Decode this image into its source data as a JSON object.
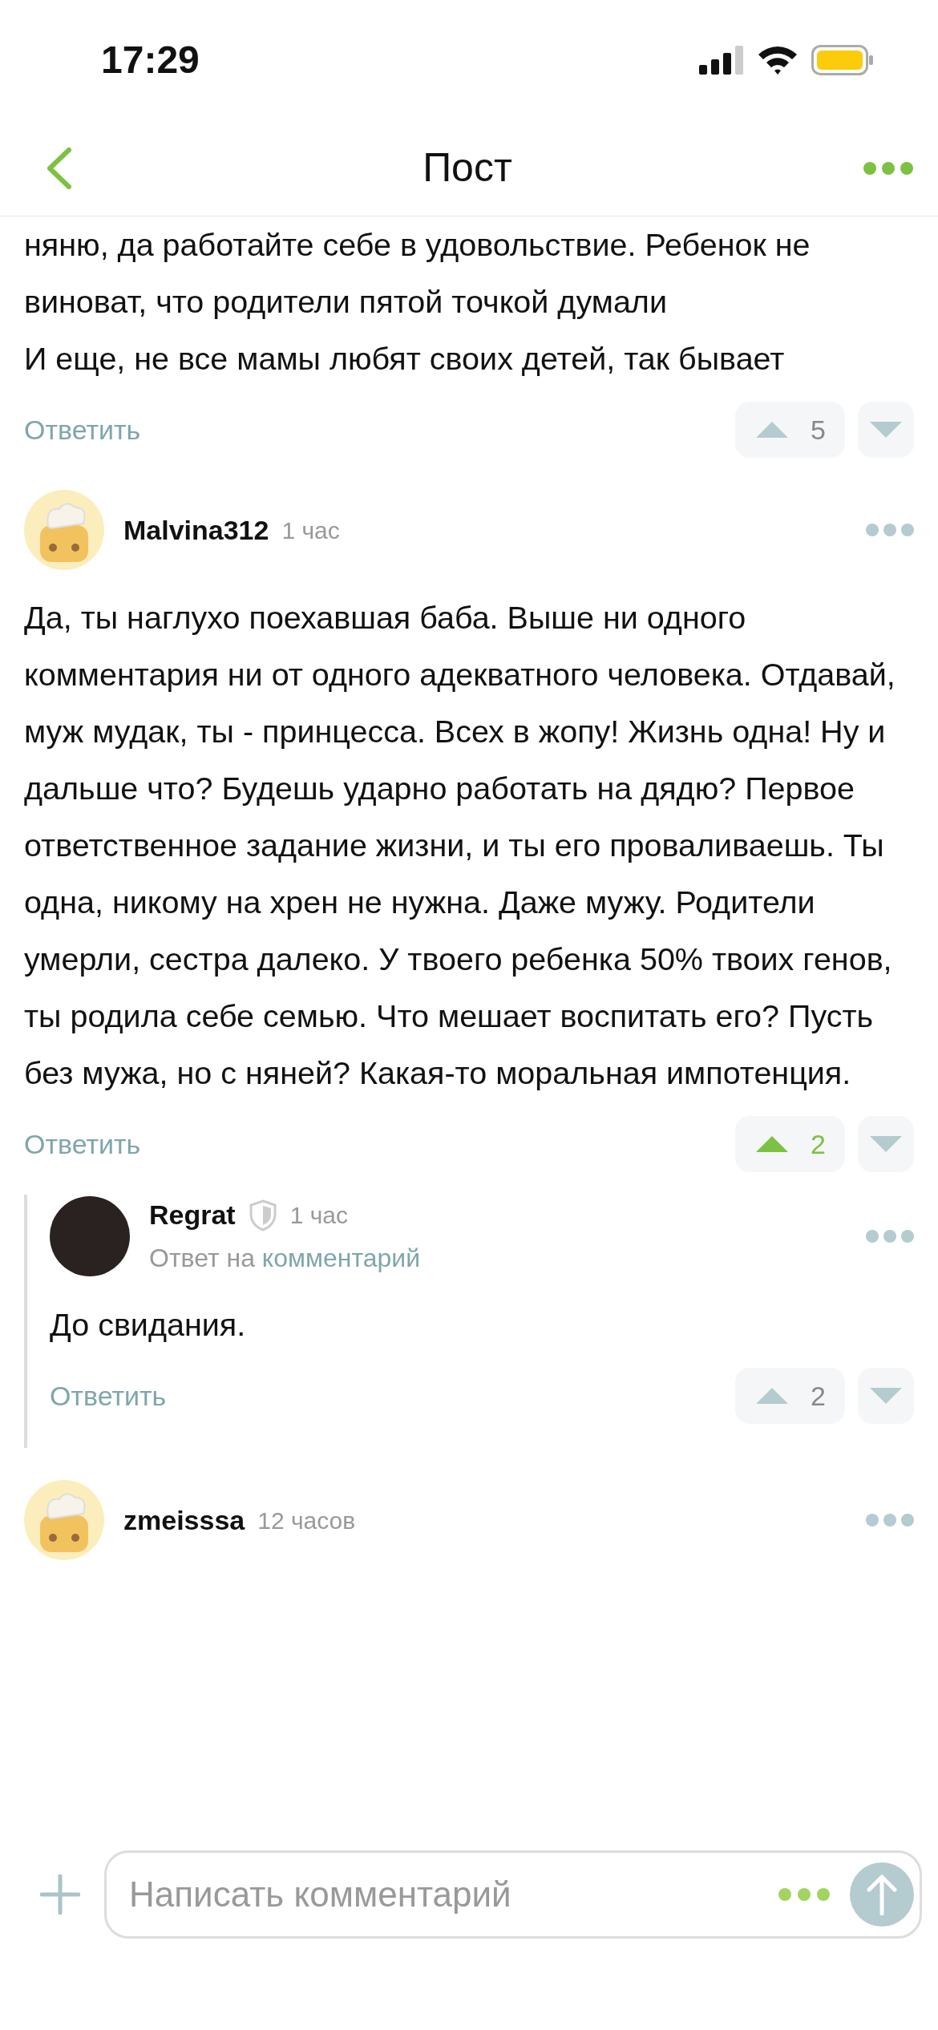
{
  "status_bar": {
    "time": "17:29"
  },
  "header": {
    "title": "Пост"
  },
  "comments": [
    {
      "kind": "continued",
      "text": [
        "няню, да работайте себе в удовольствие. Ребенок не виноват, что родители пятой точкой думали",
        "И еще, не все мамы любят своих детей, так бывает"
      ],
      "reply_label": "Ответить",
      "votes": {
        "count": "5",
        "upvoted": false
      }
    },
    {
      "kind": "full",
      "author": "Malvina312",
      "avatar": {
        "kind": "cartoon"
      },
      "time": "1 час",
      "text": [
        "Да, ты наглухо поехавшая баба. Выше ни одного комментария ни от одного адекватного человека. Отдавай, муж мудак, ты - принцесса. Всех в жопу! Жизнь одна! Ну и дальше что? Будешь ударно работать на дядю? Первое ответственное задание жизни, и ты его проваливаешь. Ты одна, никому на хрен не нужна. Даже мужу. Родители умерли, сестра далеко. У твоего ребенка 50% твоих генов, ты родила себе семью. Что мешает воспитать его? Пусть без мужа, но с няней? Какая-то моральная импотенция."
      ],
      "reply_label": "Ответить",
      "votes": {
        "count": "2",
        "upvoted": true
      },
      "replies": [
        {
          "kind": "full",
          "author": "Regrat",
          "avatar": {
            "kind": "photo"
          },
          "shield": true,
          "time": "1 час",
          "reply_to": {
            "prefix": "Ответ на",
            "link": "комментарий"
          },
          "text": [
            "До свидания."
          ],
          "reply_label": "Ответить",
          "votes": {
            "count": "2",
            "upvoted": false
          }
        }
      ]
    },
    {
      "kind": "header_only",
      "author": "zmeisssa",
      "avatar": {
        "kind": "cartoon"
      },
      "time": "12 часов"
    }
  ],
  "composer": {
    "placeholder": "Написать комментарий"
  }
}
